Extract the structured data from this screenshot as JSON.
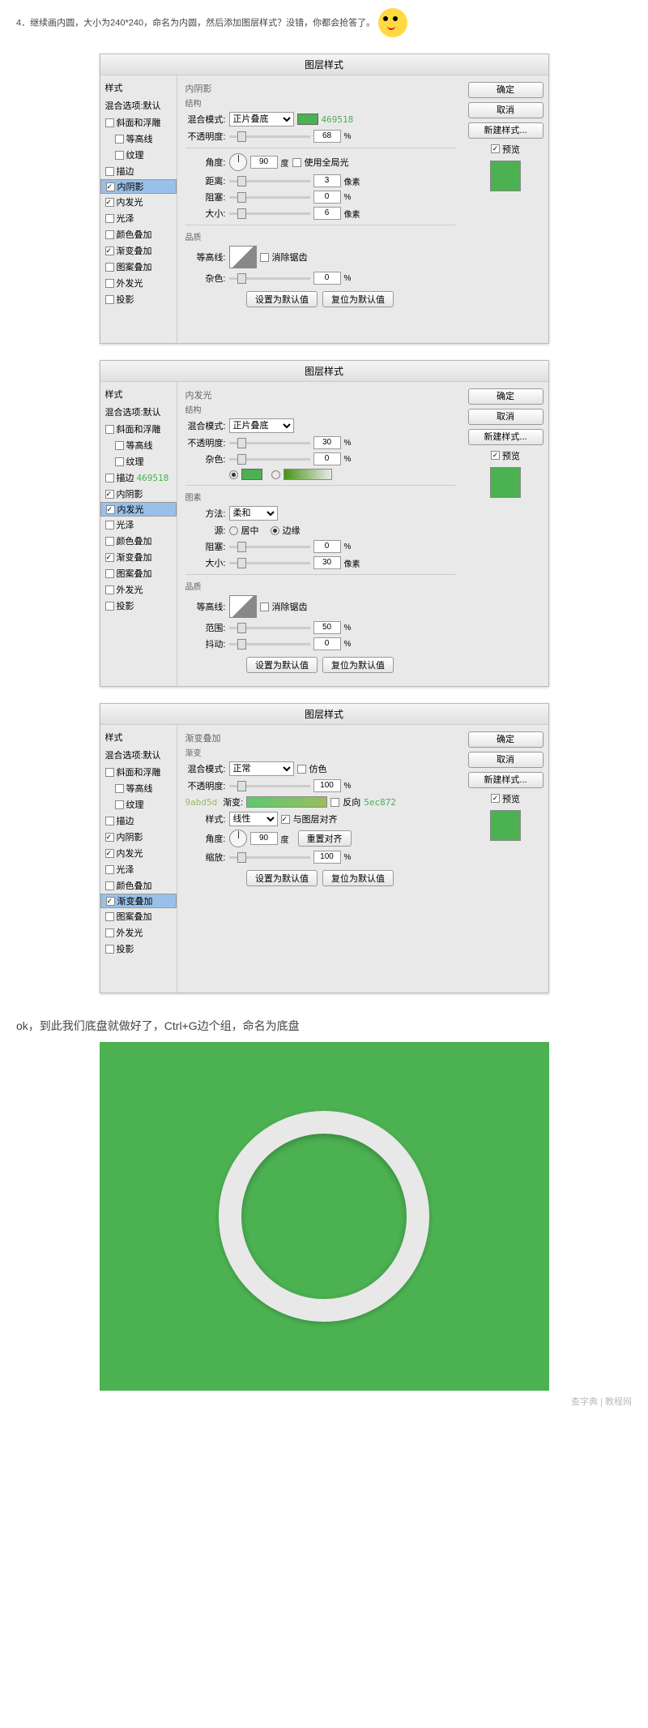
{
  "intro1": "4．继续画内圆，大小为240*240，命名为内圆，然后添加图层样式？没错，你都会抢答了。",
  "dlg_title": "图层样式",
  "styles": {
    "hdr1": "样式",
    "hdr2": "混合选项:默认",
    "items": [
      "斜面和浮雕",
      "等高线",
      "纹理",
      "描边",
      "内阴影",
      "内发光",
      "光泽",
      "颜色叠加",
      "渐变叠加",
      "图案叠加",
      "外发光",
      "投影"
    ]
  },
  "right": {
    "ok": "确定",
    "cancel": "取消",
    "newstyle": "新建样式...",
    "preview": "预览"
  },
  "actions": {
    "default": "设置为默认值",
    "reset": "复位为默认值"
  },
  "hex1": "469518",
  "hex2": "9abd5d",
  "hex3": "5ec872",
  "d1": {
    "title": "内阴影",
    "sub": "结构",
    "blend": "混合模式:",
    "blend_v": "正片叠底",
    "opacity": "不透明度:",
    "opacity_v": "68",
    "angle": "角度:",
    "angle_v": "90",
    "deg": "度",
    "global": "使用全局光",
    "distance": "距离:",
    "distance_v": "3",
    "px": "像素",
    "choke": "阻塞:",
    "choke_v": "0",
    "size": "大小:",
    "size_v": "6",
    "quality": "品质",
    "contour": "等高线:",
    "antialias": "消除锯齿",
    "noise": "杂色:",
    "noise_v": "0",
    "pct": "%"
  },
  "d2": {
    "title": "内发光",
    "sub": "结构",
    "blend": "混合模式:",
    "blend_v": "正片叠底",
    "opacity": "不透明度:",
    "opacity_v": "30",
    "noise": "杂色:",
    "noise_v": "0",
    "elements": "图素",
    "method": "方法:",
    "method_v": "柔和",
    "source": "源:",
    "center": "居中",
    "edge": "边缘",
    "choke": "阻塞:",
    "choke_v": "0",
    "size": "大小:",
    "size_v": "30",
    "px": "像素",
    "quality": "品质",
    "contour": "等高线:",
    "antialias": "消除锯齿",
    "range": "范围:",
    "range_v": "50",
    "jitter": "抖动:",
    "jitter_v": "0",
    "pct": "%"
  },
  "d3": {
    "title": "渐变叠加",
    "sub": "渐变",
    "blend": "混合模式:",
    "blend_v": "正常",
    "dither": "仿色",
    "opacity": "不透明度:",
    "opacity_v": "100",
    "gradient": "渐变:",
    "reverse": "反向",
    "style": "样式:",
    "style_v": "线性",
    "align": "与图层对齐",
    "angle": "角度:",
    "angle_v": "90",
    "deg": "度",
    "reset": "重置对齐",
    "scale": "缩放:",
    "scale_v": "100",
    "pct": "%"
  },
  "outro": "ok，到此我们底盘就做好了，Ctrl+G边个组，命名为底盘",
  "watermark": "查字典 | 教程网"
}
